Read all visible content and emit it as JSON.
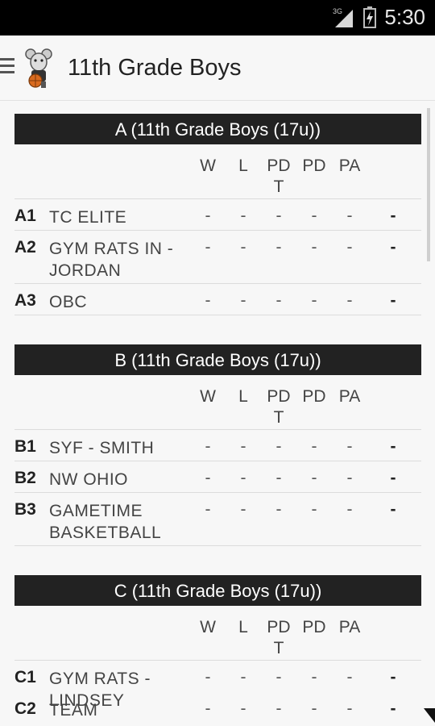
{
  "status_bar": {
    "time": "5:30",
    "network": "3G"
  },
  "app_bar": {
    "title": "11th Grade Boys"
  },
  "columns": [
    "W",
    "L",
    "PDT",
    "PD",
    "PA"
  ],
  "groups": [
    {
      "header": "A (11th Grade Boys (17u))",
      "rows": [
        {
          "seed": "A1",
          "team": "TC ELITE",
          "values": [
            "-",
            "-",
            "-",
            "-",
            "-",
            "-"
          ]
        },
        {
          "seed": "A2",
          "team": "GYM RATS IN - JORDAN",
          "values": [
            "-",
            "-",
            "-",
            "-",
            "-",
            "-"
          ]
        },
        {
          "seed": "A3",
          "team": "OBC",
          "values": [
            "-",
            "-",
            "-",
            "-",
            "-",
            "-"
          ]
        }
      ]
    },
    {
      "header": "B (11th Grade Boys (17u))",
      "rows": [
        {
          "seed": "B1",
          "team": "SYF - SMITH",
          "values": [
            "-",
            "-",
            "-",
            "-",
            "-",
            "-"
          ]
        },
        {
          "seed": "B2",
          "team": "NW OHIO",
          "values": [
            "-",
            "-",
            "-",
            "-",
            "-",
            "-"
          ]
        },
        {
          "seed": "B3",
          "team": "GAMETIME BASKETBALL",
          "values": [
            "-",
            "-",
            "-",
            "-",
            "-",
            "-"
          ]
        }
      ]
    },
    {
      "header": "C (11th Grade Boys (17u))",
      "rows": [
        {
          "seed": "C1",
          "team": "GYM RATS - LINDSEY",
          "values": [
            "-",
            "-",
            "-",
            "-",
            "-",
            "-"
          ]
        },
        {
          "seed": "C2",
          "team": "TEAM",
          "values": [
            "-",
            "-",
            "-",
            "-",
            "-",
            "-"
          ]
        }
      ]
    }
  ]
}
